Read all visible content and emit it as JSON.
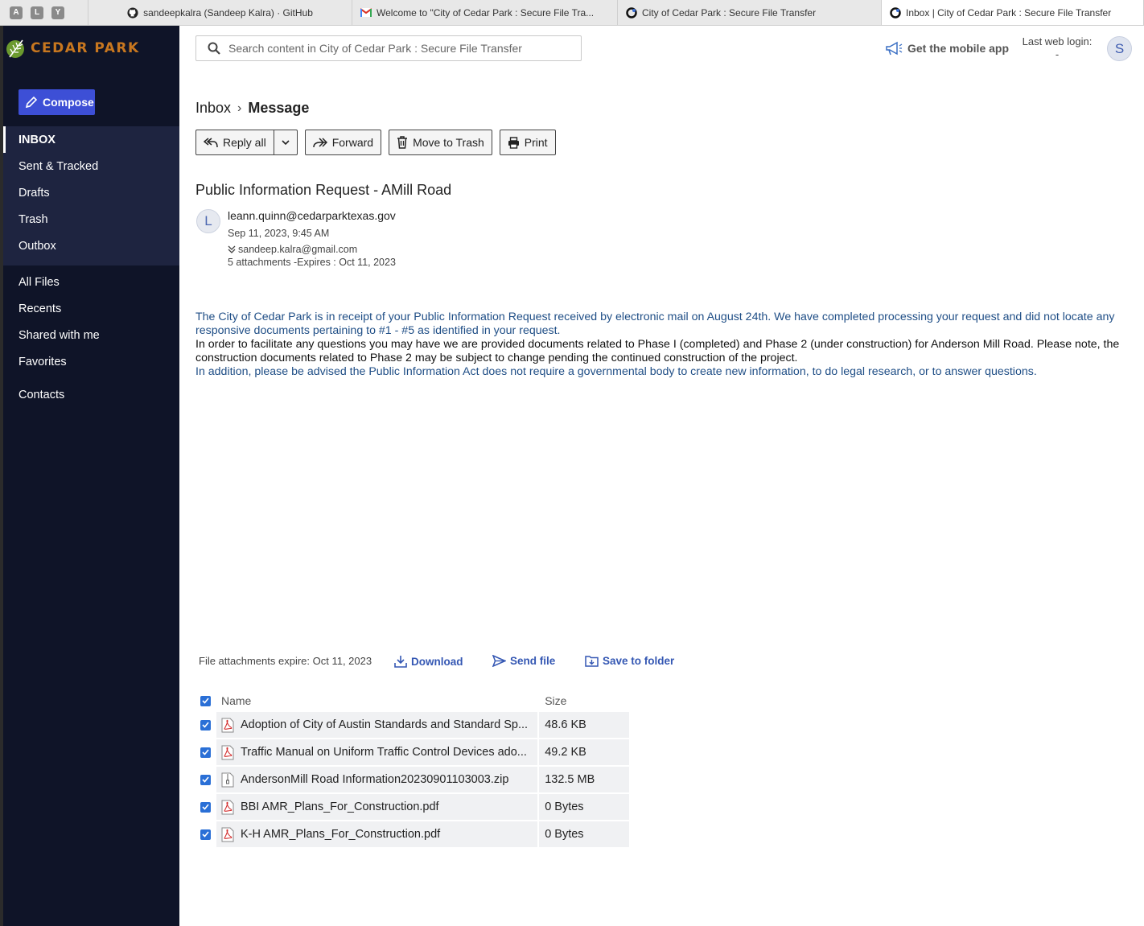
{
  "browser": {
    "pinned": [
      "A",
      "L",
      "Y"
    ],
    "tabs": [
      {
        "title": "sandeepkalra (Sandeep Kalra) · GitHub",
        "icon": "github-icon"
      },
      {
        "title": "Welcome to \"City of Cedar Park : Secure File Tra...",
        "icon": "gmail-icon"
      },
      {
        "title": "City of Cedar Park : Secure File Transfer",
        "icon": "site-icon"
      },
      {
        "title": "Inbox | City of Cedar Park : Secure File Transfer",
        "icon": "site-icon"
      }
    ]
  },
  "sidebar": {
    "logo": "CEDAR PARK",
    "compose": "Compose",
    "mail_items": [
      "INBOX",
      "Sent & Tracked",
      "Drafts",
      "Trash",
      "Outbox"
    ],
    "file_items": [
      "All Files",
      "Recents",
      "Shared with me",
      "Favorites"
    ],
    "contact_items": [
      "Contacts"
    ]
  },
  "header": {
    "search_placeholder": "Search content in City of Cedar Park : Secure File Transfer",
    "mobile_app": "Get the mobile app",
    "last_login_label": "Last web login:",
    "last_login_value": "-",
    "user_initial": "S"
  },
  "breadcrumb": {
    "parent": "Inbox",
    "separator": "›",
    "current": "Message"
  },
  "toolbar": {
    "reply_all": "Reply all",
    "forward": "Forward",
    "trash": "Move to Trash",
    "print": "Print"
  },
  "message": {
    "subject": "Public Information Request - AMill Road",
    "sender_initial": "L",
    "from": "leann.quinn@cedarparktexas.gov",
    "date": "Sep 11, 2023, 9:45 AM",
    "to": "sandeep.kalra@gmail.com",
    "attachments_summary": "5 attachments -Expires : Oct 11, 2023",
    "body": {
      "p1": "The City of Cedar Park is in receipt of your Public Information Request received by electronic mail on August 24th.  We have completed processing your request and did not locate any responsive documents pertaining to #1 - #5 as identified in your request.",
      "p2": "In order to facilitate any questions you may have we are provided documents related to Phase I (completed) and Phase 2 (under construction) for Anderson Mill Road.  Please note, the construction documents related to Phase 2 may be subject to change pending the continued construction of the project.",
      "p3": "In addition, please be advised the Public Information Act does not require a governmental body to create new information, to do legal research, or to answer questions."
    }
  },
  "attachments": {
    "expires": "File attachments expire: Oct 11, 2023",
    "download": "Download",
    "send": "Send file",
    "save": "Save to folder",
    "col_name": "Name",
    "col_size": "Size",
    "files": [
      {
        "name": "Adoption of City of Austin Standards and Standard Sp...",
        "size": "48.6 KB",
        "icon": "pdf-icon"
      },
      {
        "name": "Traffic Manual on Uniform Traffic Control Devices ado...",
        "size": "49.2 KB",
        "icon": "pdf-icon"
      },
      {
        "name": "AndersonMill Road Information20230901103003.zip",
        "size": "132.5 MB",
        "icon": "zip-icon"
      },
      {
        "name": "BBI AMR_Plans_For_Construction.pdf",
        "size": "0 Bytes",
        "icon": "pdf-icon"
      },
      {
        "name": "K-H AMR_Plans_For_Construction.pdf",
        "size": "0 Bytes",
        "icon": "pdf-icon"
      }
    ]
  },
  "colors": {
    "sidebar_bg": "#0f1428",
    "sidebar_group_bg": "#1e2440",
    "compose_bg": "#3d4fd6",
    "brand_orange": "#c8771f",
    "link_blue": "#3457b3",
    "body_blue": "#1f4e86"
  }
}
